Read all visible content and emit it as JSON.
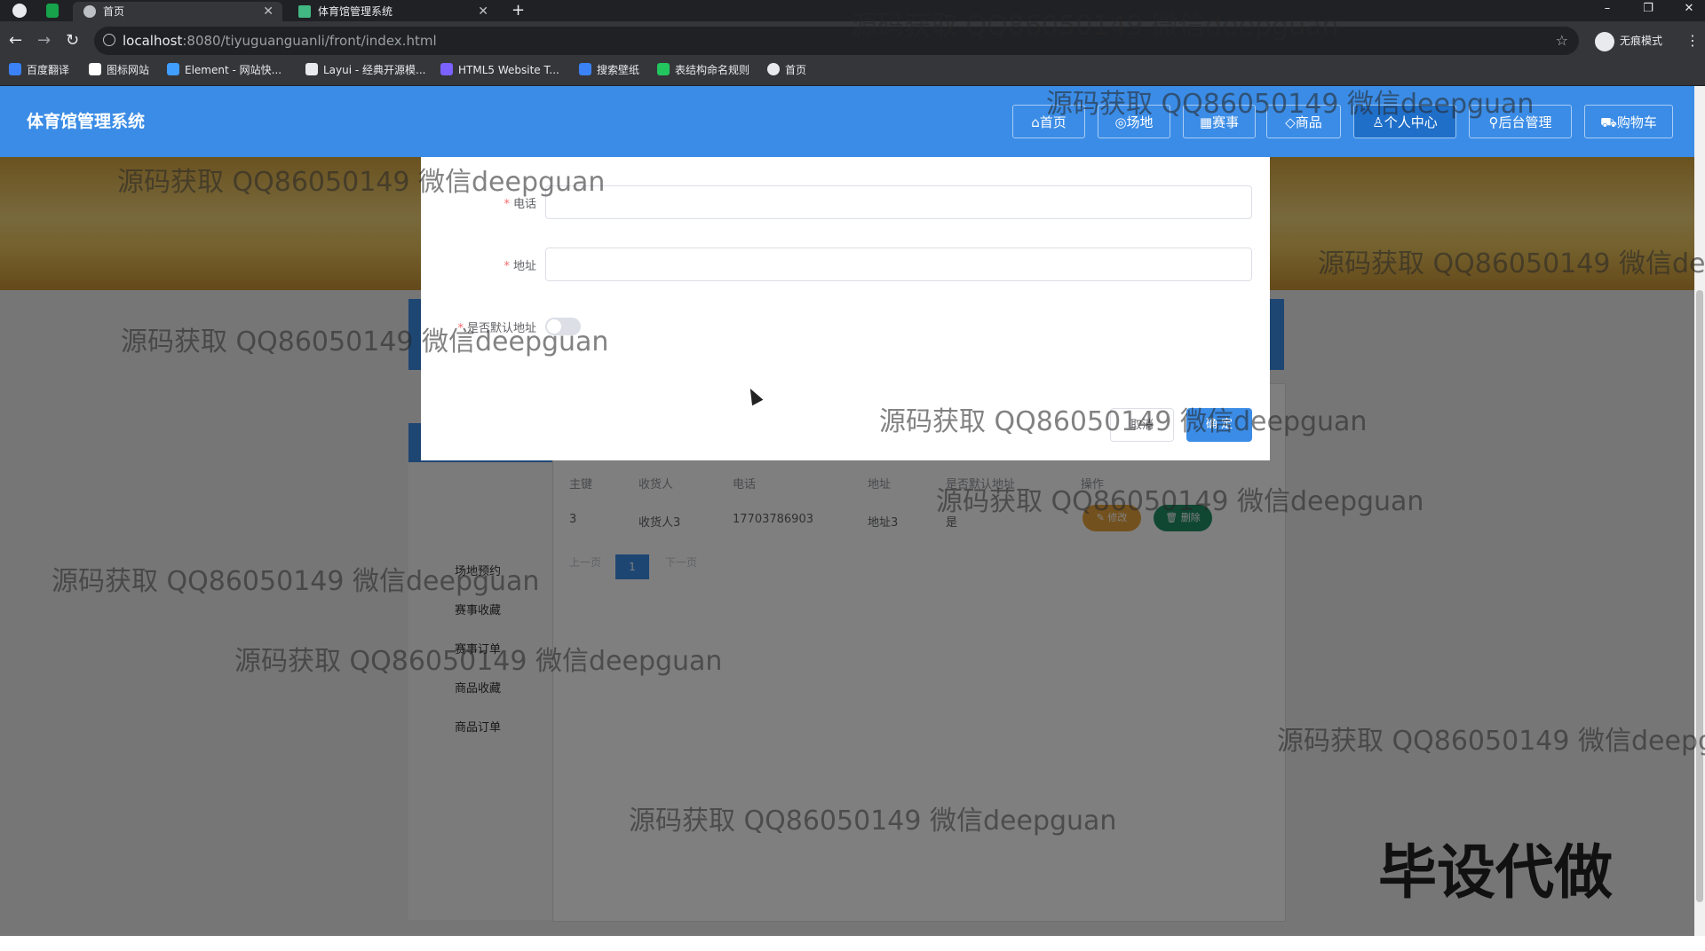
{
  "browser": {
    "tabs": [
      {
        "title": "首页",
        "active": true
      },
      {
        "title": "体育馆管理系统",
        "active": false
      }
    ],
    "new_tab": "+",
    "window_controls": [
      "–",
      "❐",
      "✕"
    ],
    "url_host": "localhost",
    "url_rest": ":8080/tiyuguanguanli/front/index.html",
    "profile": "无痕模式",
    "bookmarks": [
      {
        "label": "百度翻译",
        "color": "#3b82f6"
      },
      {
        "label": "图标网站",
        "color": "#ffffff"
      },
      {
        "label": "Element - 网站快...",
        "color": "#409eff"
      },
      {
        "label": "Layui - 经典开源模...",
        "color": "#e8eaed"
      },
      {
        "label": "HTML5 Website T...",
        "color": "#7b61ff"
      },
      {
        "label": "搜索壁纸",
        "color": "#3b82f6"
      },
      {
        "label": "表结构命名规则",
        "color": "#22c55e"
      },
      {
        "label": "首页",
        "color": "#e8eaed"
      }
    ]
  },
  "app": {
    "brand": "体育馆管理系统",
    "nav": [
      {
        "label": "⌂首页",
        "active": false
      },
      {
        "label": "◎场地",
        "active": false
      },
      {
        "label": "▦赛事",
        "active": false
      },
      {
        "label": "◇商品",
        "active": false
      },
      {
        "label": "♙个人中心",
        "active": true
      },
      {
        "label": "⚲后台管理",
        "active": false
      },
      {
        "label": "⛟购物车",
        "active": false
      }
    ],
    "sidebar": [
      "场地预约",
      "赛事收藏",
      "赛事订单",
      "商品收藏",
      "商品订单"
    ],
    "table": {
      "headers": [
        "主键",
        "收货人",
        "电话",
        "地址",
        "是否默认地址",
        "操作"
      ],
      "rows": [
        {
          "id": "3",
          "name": "收货人3",
          "phone": "17703786903",
          "address": "地址3",
          "default": "是"
        }
      ],
      "edit_label": "✎ 修改",
      "delete_label": "🗑 删除"
    },
    "pager": {
      "prev": "上一页",
      "current": "1",
      "next": "下一页"
    }
  },
  "dialog": {
    "phone_label": "电话",
    "address_label": "地址",
    "default_label": "是否默认地址",
    "required_mark": "*",
    "default_on": false,
    "cancel": "取消",
    "confirm": "确 定"
  },
  "watermark": {
    "text": "源码获取 QQ86050149 微信deepguan",
    "clipped_text": "源码获取 QQ86050149 微信dee",
    "clipped_text2": "源码获取 QQ86050149 微信deepg",
    "corner": "毕设代做"
  },
  "colors": {
    "primary": "#3b8ce6",
    "nav_active": "#1f6fc9",
    "edit": "#e6a23c",
    "delete": "#1f8f66"
  }
}
